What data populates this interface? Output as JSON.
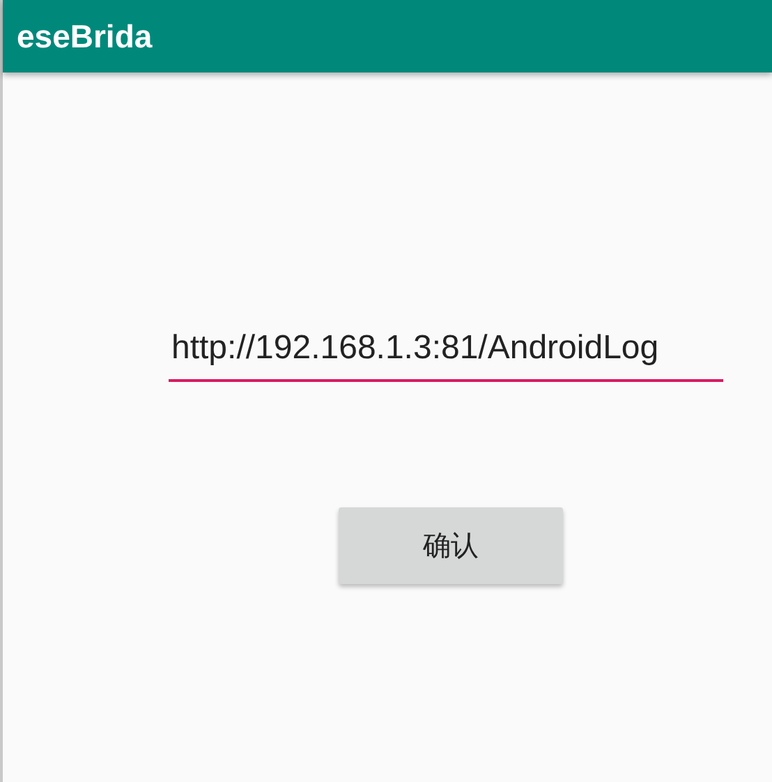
{
  "app_bar": {
    "title": "eseBrida"
  },
  "url_field": {
    "value": "http://192.168.1.3:81/AndroidLog",
    "focused": true
  },
  "confirm_button": {
    "label": "确认"
  }
}
